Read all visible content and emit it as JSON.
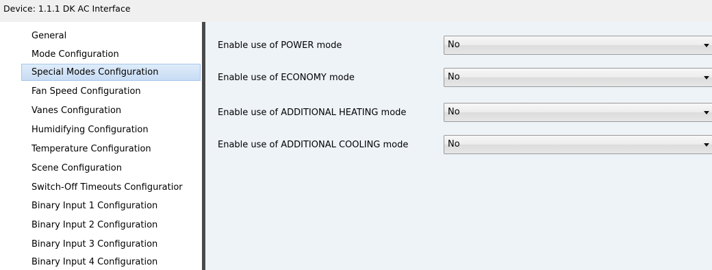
{
  "device": {
    "title": "Device: 1.1.1  DK AC Interface"
  },
  "sidebar": {
    "items": [
      {
        "label": "General",
        "selected": false
      },
      {
        "label": "Mode Configuration",
        "selected": false
      },
      {
        "label": "Special Modes Configuration",
        "selected": true
      },
      {
        "label": "Fan Speed Configuration",
        "selected": false
      },
      {
        "label": "Vanes Configuration",
        "selected": false
      },
      {
        "label": "Humidifying Configuration",
        "selected": false
      },
      {
        "label": "Temperature Configuration",
        "selected": false
      },
      {
        "label": "Scene Configuration",
        "selected": false
      },
      {
        "label": "Switch-Off Timeouts Configuratior",
        "selected": false
      },
      {
        "label": "Binary Input 1 Configuration",
        "selected": false
      },
      {
        "label": "Binary Input 2 Configuration",
        "selected": false
      },
      {
        "label": "Binary Input 3 Configuration",
        "selected": false
      },
      {
        "label": "Binary Input 4 Configuration",
        "selected": false
      }
    ]
  },
  "parameters": [
    {
      "label": "Enable use of POWER mode",
      "value": "No"
    },
    {
      "label": "Enable use of ECONOMY mode",
      "value": "No"
    },
    {
      "label": "Enable use of ADDITIONAL HEATING mode",
      "value": "No"
    },
    {
      "label": "Enable use of ADDITIONAL COOLING mode",
      "value": "No"
    }
  ],
  "icons": {
    "dropdown": "chevron-down-icon"
  },
  "colors": {
    "selection_fill": "#c7dcf4",
    "selection_border": "#a6c6ec",
    "content_background": "#eef3f8",
    "splitter": "#4a4a4a",
    "title_bar": "#f0f0f0"
  }
}
